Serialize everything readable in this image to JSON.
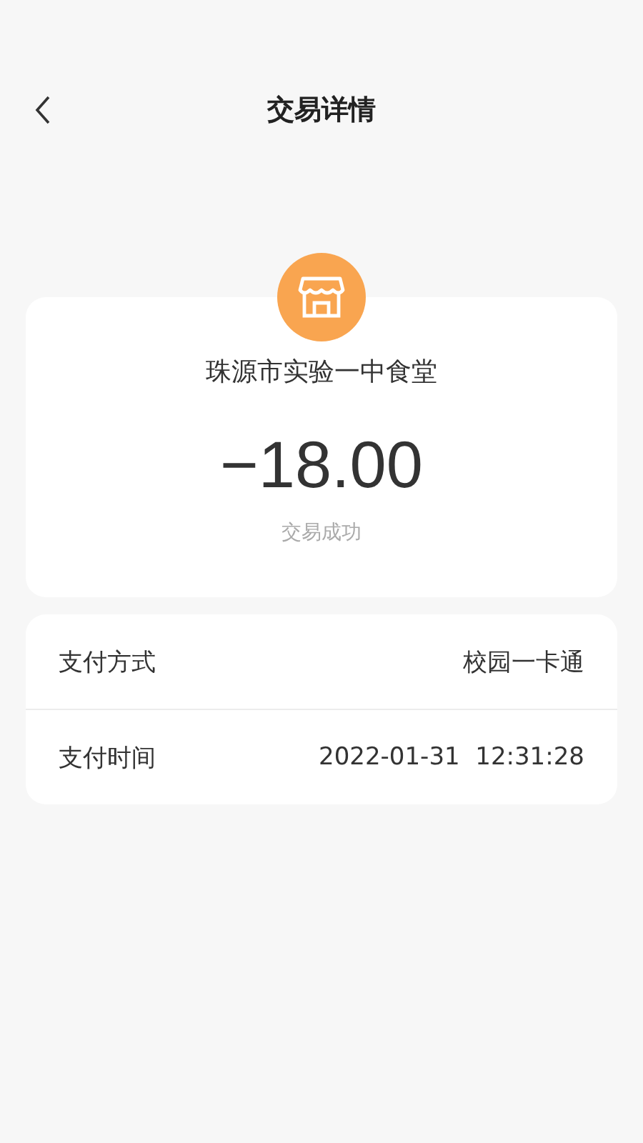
{
  "header": {
    "title": "交易详情"
  },
  "transaction": {
    "merchant": "珠源市实验一中食堂",
    "amount": "−18.00",
    "status": "交易成功"
  },
  "details": [
    {
      "label": "支付方式",
      "value": "校园一卡通"
    },
    {
      "label": "支付时间",
      "value": "2022-01-31  12:31:28"
    }
  ]
}
